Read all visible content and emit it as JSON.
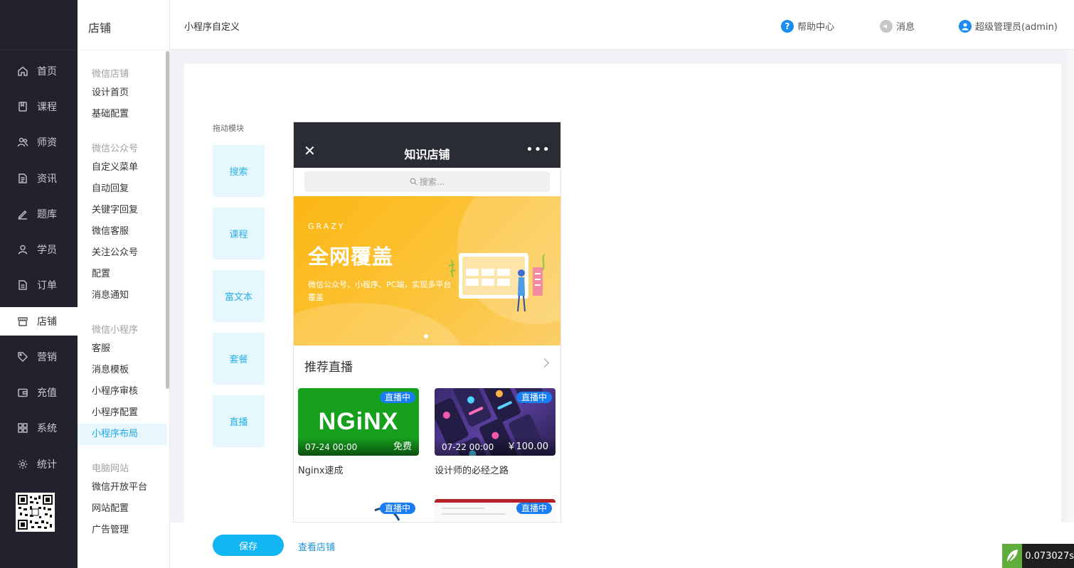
{
  "nav": {
    "items": [
      {
        "label": "首页",
        "icon": "home-icon"
      },
      {
        "label": "课程",
        "icon": "book-icon"
      },
      {
        "label": "师资",
        "icon": "teacher-icon"
      },
      {
        "label": "资讯",
        "icon": "news-icon"
      },
      {
        "label": "题库",
        "icon": "pen-icon"
      },
      {
        "label": "学员",
        "icon": "user-icon"
      },
      {
        "label": "订单",
        "icon": "order-icon"
      },
      {
        "label": "店铺",
        "icon": "store-icon"
      },
      {
        "label": "营销",
        "icon": "tag-icon"
      },
      {
        "label": "充值",
        "icon": "wallet-icon"
      },
      {
        "label": "系统",
        "icon": "grid-icon"
      },
      {
        "label": "统计",
        "icon": "gear-icon"
      }
    ],
    "active": "店铺"
  },
  "subnav": {
    "title": "店铺",
    "groups": [
      {
        "title": "微信店铺",
        "items": [
          "设计首页",
          "基础配置"
        ]
      },
      {
        "title": "微信公众号",
        "items": [
          "自定义菜单",
          "自动回复",
          "关键字回复",
          "微信客服",
          "关注公众号",
          "配置",
          "消息通知"
        ]
      },
      {
        "title": "微信小程序",
        "items": [
          "客服",
          "消息模板",
          "小程序审核",
          "小程序配置",
          "小程序布局"
        ]
      },
      {
        "title": "电脑网站",
        "items": [
          "微信开放平台",
          "网站配置",
          "广告管理"
        ]
      }
    ],
    "active": "小程序布局"
  },
  "header": {
    "page_title": "小程序自定义",
    "help": "帮助中心",
    "messages": "消息",
    "user": "超级管理员(admin)"
  },
  "editor": {
    "drag_label": "拖动模块",
    "modules": [
      "搜索",
      "课程",
      "富文本",
      "套餐",
      "直播"
    ]
  },
  "phone": {
    "title": "知识店铺",
    "search_placeholder": "搜索...",
    "banner": {
      "sub": "GRAZY",
      "title": "全网覆盖",
      "desc": "微信公众号、小程序、PC端，实现多平台覆盖"
    },
    "section_title": "推荐直播",
    "badge": "直播中",
    "courses": [
      {
        "name": "Nginx速成",
        "date": "07-24 00:00",
        "price": "免费",
        "logo": "NGiNX"
      },
      {
        "name": "设计师的必经之路",
        "date": "07-22 00:00",
        "price": "￥100.00"
      }
    ]
  },
  "footer": {
    "save": "保存",
    "view": "查看店铺"
  },
  "timer": "0.073027s",
  "colors": {
    "accent": "#12b6f2",
    "sidebar": "#22222f",
    "badge": "#1a7ef2"
  }
}
